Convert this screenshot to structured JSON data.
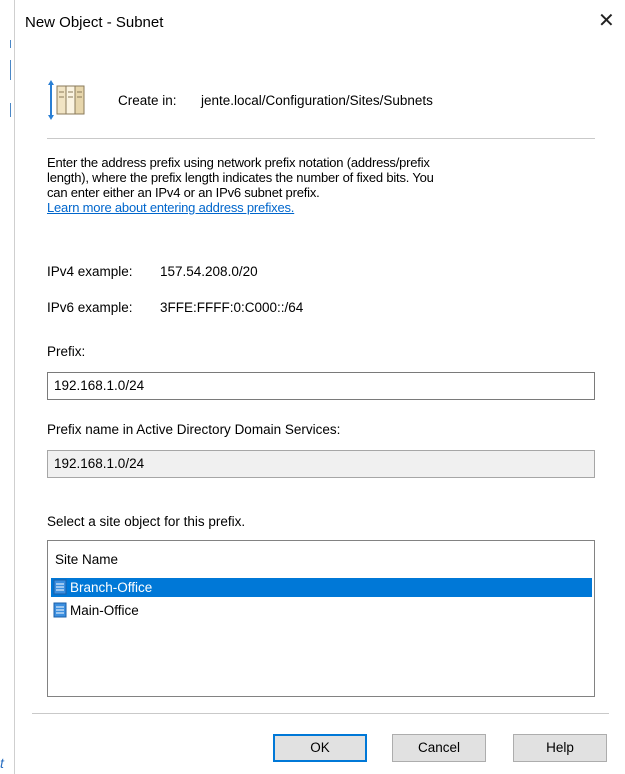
{
  "window": {
    "title": "New Object - Subnet",
    "close_glyph": "✕"
  },
  "header": {
    "icon": "subnet-object-icon",
    "create_in_label": "Create in:",
    "create_in_path": "jente.local/Configuration/Sites/Subnets"
  },
  "description": {
    "line1": "Enter the address prefix using network prefix notation (address/prefix",
    "line2": "length), where the prefix length indicates the number of fixed bits. You",
    "line3": "can enter either an IPv4 or an IPv6 subnet prefix.",
    "link": "Learn more about entering address prefixes."
  },
  "examples": {
    "ipv4_label": "IPv4 example:",
    "ipv4_value": "157.54.208.0/20",
    "ipv6_label": "IPv6 example:",
    "ipv6_value": "3FFE:FFFF:0:C000::/64"
  },
  "prefix": {
    "label": "Prefix:",
    "value": "192.168.1.0/24"
  },
  "prefix_name": {
    "label": "Prefix name in Active Directory Domain Services:",
    "value": "192.168.1.0/24"
  },
  "sites": {
    "label": "Select a site object for this prefix.",
    "column_header": "Site Name",
    "items": [
      {
        "label": "Branch-Office",
        "selected": true
      },
      {
        "label": "Main-Office",
        "selected": false
      }
    ],
    "selection_color": "#0078d7"
  },
  "buttons": {
    "ok": "OK",
    "cancel": "Cancel",
    "help": "Help"
  },
  "edge_fragment": "t"
}
